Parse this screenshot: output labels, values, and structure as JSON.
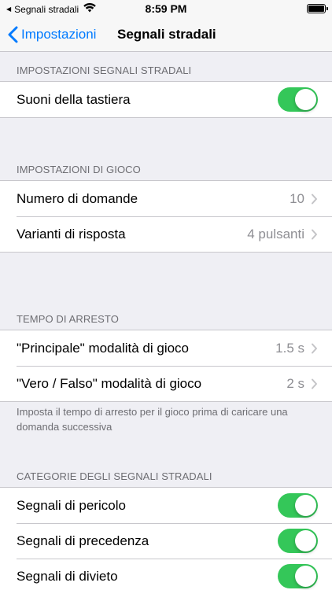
{
  "status_bar": {
    "back_app": "Segnali stradali",
    "time": "8:59 PM"
  },
  "nav": {
    "back_label": "Impostazioni",
    "title": "Segnali stradali"
  },
  "sections": {
    "road_sign_settings": {
      "header": "IMPOSTAZIONI SEGNALI STRADALI",
      "keyboard_sounds": {
        "label": "Suoni della tastiera",
        "on": true
      }
    },
    "game_settings": {
      "header": "IMPOSTAZIONI DI GIOCO",
      "question_count": {
        "label": "Numero di domande",
        "value": "10"
      },
      "answer_variants": {
        "label": "Varianti di risposta",
        "value": "4 pulsanti"
      }
    },
    "stop_time": {
      "header": "TEMPO DI ARRESTO",
      "main_mode": {
        "label": "\"Principale\" modalità di gioco",
        "value": "1.5 s"
      },
      "true_false_mode": {
        "label": "\"Vero / Falso\" modalità di gioco",
        "value": "2 s"
      },
      "footer": "Imposta il tempo di arresto per il gioco prima di caricare una domanda successiva"
    },
    "categories": {
      "header": "CATEGORIE DEGLI SEGNALI STRADALI",
      "items": [
        {
          "label": "Segnali di pericolo",
          "on": true
        },
        {
          "label": "Segnali di precedenza",
          "on": true
        },
        {
          "label": "Segnali di divieto",
          "on": true
        }
      ]
    }
  },
  "colors": {
    "accent": "#007aff",
    "toggle_on": "#34c759",
    "background": "#efeff4",
    "secondary_text": "#8e8e93"
  }
}
